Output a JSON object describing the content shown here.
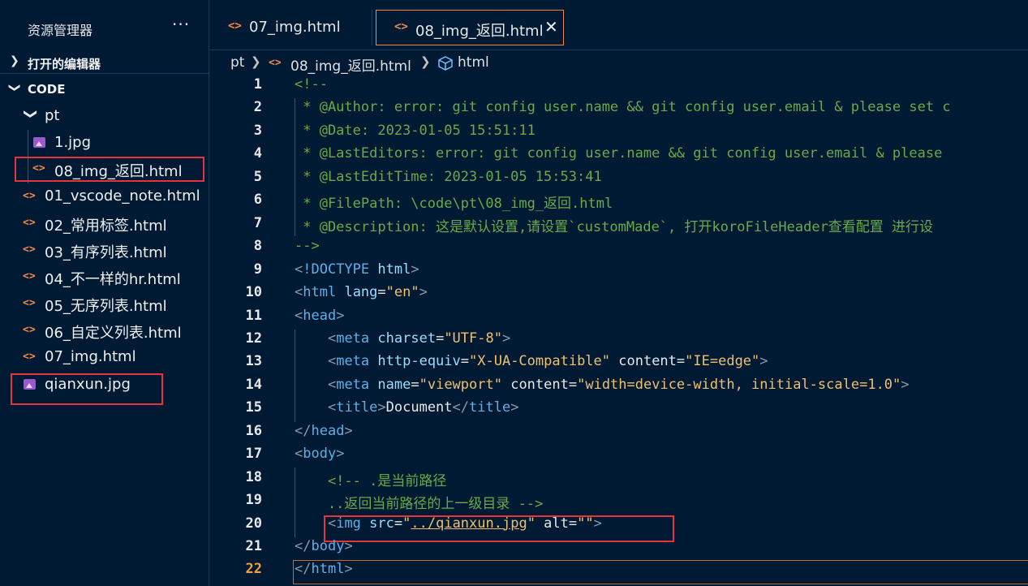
{
  "sidebar": {
    "title": "资源管理器",
    "more": "···",
    "open_editors": "打开的编辑器",
    "root": "CODE",
    "folder": "pt",
    "items": [
      {
        "label": "1.jpg",
        "icon": "image-file-icon"
      },
      {
        "label": "08_img_返回.html",
        "icon": "html-file-icon"
      },
      {
        "label": "01_vscode_note.html",
        "icon": "html-file-icon"
      },
      {
        "label": "02_常用标签.html",
        "icon": "html-file-icon"
      },
      {
        "label": "03_有序列表.html",
        "icon": "html-file-icon"
      },
      {
        "label": "04_不一样的hr.html",
        "icon": "html-file-icon"
      },
      {
        "label": "05_无序列表.html",
        "icon": "html-file-icon"
      },
      {
        "label": "06_自定义列表.html",
        "icon": "html-file-icon"
      },
      {
        "label": "07_img.html",
        "icon": "html-file-icon"
      },
      {
        "label": "qianxun.jpg",
        "icon": "image-file-icon"
      }
    ]
  },
  "tabs": [
    {
      "label": "07_img.html",
      "active": false
    },
    {
      "label": "08_img_返回.html",
      "active": true
    }
  ],
  "breadcrumb": {
    "folder": "pt",
    "file": "08_img_返回.html",
    "symbol": "html"
  },
  "editor": {
    "current_line": 22,
    "lines": [
      {
        "n": "1",
        "t": "<!--"
      },
      {
        "n": "2",
        "t": " * @Author: error: git config user.name && git config user.email & please set c"
      },
      {
        "n": "3",
        "t": " * @Date: 2023-01-05 15:51:11"
      },
      {
        "n": "4",
        "t": " * @LastEditors: error: git config user.name && git config user.email & please"
      },
      {
        "n": "5",
        "t": " * @LastEditTime: 2023-01-05 15:53:41"
      },
      {
        "n": "6",
        "t": " * @FilePath: \\code\\pt\\08_img_返回.html"
      },
      {
        "n": "7",
        "t": " * @Description: 这是默认设置,请设置`customMade`, 打开koroFileHeader查看配置 进行设"
      },
      {
        "n": "8",
        "t": "-->"
      },
      {
        "n": "9",
        "t": "<!DOCTYPE html>"
      },
      {
        "n": "10",
        "t": "<html lang=\"en\">"
      },
      {
        "n": "11",
        "t": "<head>"
      },
      {
        "n": "12",
        "t": "    <meta charset=\"UTF-8\">"
      },
      {
        "n": "13",
        "t": "    <meta http-equiv=\"X-UA-Compatible\" content=\"IE=edge\">"
      },
      {
        "n": "14",
        "t": "    <meta name=\"viewport\" content=\"width=device-width, initial-scale=1.0\">"
      },
      {
        "n": "15",
        "t": "    <title>Document</title>"
      },
      {
        "n": "16",
        "t": "</head>"
      },
      {
        "n": "17",
        "t": "<body>"
      },
      {
        "n": "18",
        "t": "    <!-- .是当前路径"
      },
      {
        "n": "19",
        "t": "    ..返回当前路径的上一级目录 -->"
      },
      {
        "n": "20",
        "t": "    <img src=\"../qianxun.jpg\" alt=\"\">"
      },
      {
        "n": "21",
        "t": "</body>"
      },
      {
        "n": "22",
        "t": "</html>"
      }
    ]
  },
  "colors": {
    "background": "#001a33",
    "highlight": "#e5343a",
    "html_icon": "#f08a4b",
    "image_icon": "#9b59d0",
    "comment": "#6aaa4a",
    "tag": "#5eb0e8",
    "string": "#f0c070"
  }
}
